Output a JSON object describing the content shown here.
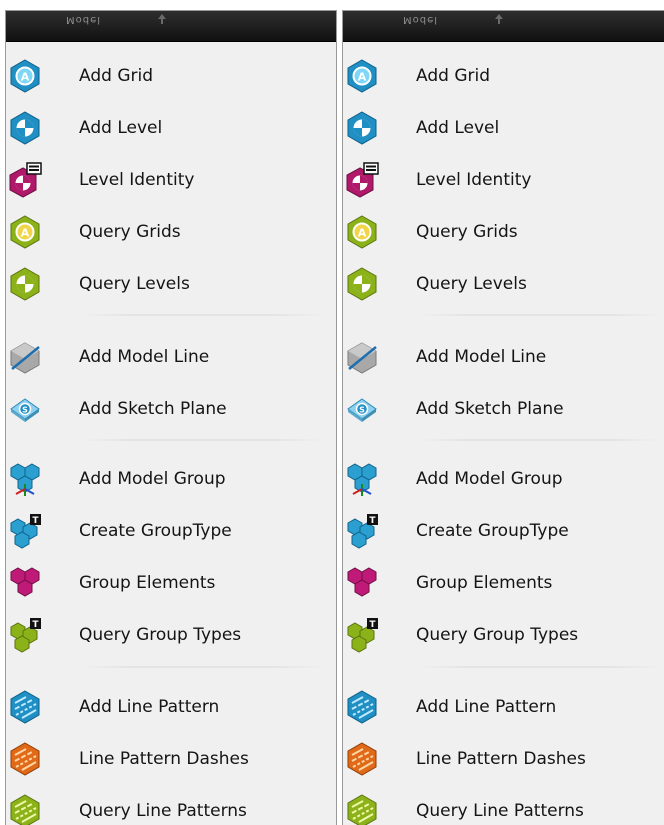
{
  "panels": [
    {
      "title": "Model",
      "items": [
        {
          "label": "Add Grid",
          "icon": "add-grid-icon"
        },
        {
          "label": "Add Level",
          "icon": "add-level-icon"
        },
        {
          "label": "Level Identity",
          "icon": "level-identity-icon"
        },
        {
          "label": "Query Grids",
          "icon": "query-grids-icon"
        },
        {
          "label": "Query Levels",
          "icon": "query-levels-icon"
        },
        {
          "label": "Add Model Line",
          "icon": "add-model-line-icon"
        },
        {
          "label": "Add Sketch Plane",
          "icon": "add-sketch-plane-icon"
        },
        {
          "label": "Add Model Group",
          "icon": "add-model-group-icon"
        },
        {
          "label": "Create GroupType",
          "icon": "create-grouptype-icon"
        },
        {
          "label": "Group Elements",
          "icon": "group-elements-icon"
        },
        {
          "label": "Query Group Types",
          "icon": "query-group-types-icon"
        },
        {
          "label": "Add Line Pattern",
          "icon": "add-line-pattern-icon"
        },
        {
          "label": "Line Pattern Dashes",
          "icon": "line-pattern-dashes-icon"
        },
        {
          "label": "Query Line Patterns",
          "icon": "query-line-patterns-icon"
        }
      ]
    },
    {
      "title": "Model",
      "items": [
        {
          "label": "Add Grid",
          "icon": "add-grid-icon"
        },
        {
          "label": "Add Level",
          "icon": "add-level-icon"
        },
        {
          "label": "Level Identity",
          "icon": "level-identity-icon"
        },
        {
          "label": "Query Grids",
          "icon": "query-grids-icon"
        },
        {
          "label": "Query Levels",
          "icon": "query-levels-icon"
        },
        {
          "label": "Add Model Line",
          "icon": "add-model-line-icon"
        },
        {
          "label": "Add Sketch Plane",
          "icon": "add-sketch-plane-icon"
        },
        {
          "label": "Add Model Group",
          "icon": "add-model-group-icon"
        },
        {
          "label": "Create GroupType",
          "icon": "create-grouptype-icon"
        },
        {
          "label": "Group Elements",
          "icon": "group-elements-icon"
        },
        {
          "label": "Query Group Types",
          "icon": "query-group-types-icon"
        },
        {
          "label": "Add Line Pattern",
          "icon": "add-line-pattern-icon"
        },
        {
          "label": "Line Pattern Dashes",
          "icon": "line-pattern-dashes-icon"
        },
        {
          "label": "Query Line Patterns",
          "icon": "query-line-patterns-icon"
        }
      ]
    }
  ],
  "colors": {
    "blue": "#1f8fc4",
    "magenta": "#b0186a",
    "green": "#8cb21a",
    "gray": "#9a9a9a",
    "orange": "#e06a18"
  }
}
